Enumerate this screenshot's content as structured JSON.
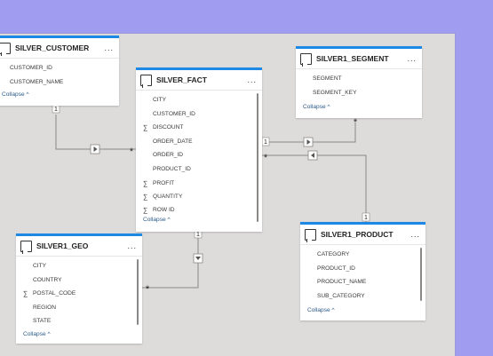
{
  "tables": {
    "customer": {
      "title": "SILVER_CUSTOMER",
      "more": "...",
      "fields": [
        "CUSTOMER_ID",
        "CUSTOMER_NAME"
      ],
      "collapse": "Collapse ^"
    },
    "segment": {
      "title": "SILVER1_SEGMENT",
      "more": "...",
      "fields": [
        "SEGMENT",
        "SEGMENT_KEY"
      ],
      "collapse": "Collapse ^"
    },
    "fact": {
      "title": "SILVER_FACT",
      "more": "...",
      "fields": [
        {
          "name": "CITY",
          "sigma": false
        },
        {
          "name": "CUSTOMER_ID",
          "sigma": false
        },
        {
          "name": "DISCOUNT",
          "sigma": true
        },
        {
          "name": "ORDER_DATE",
          "sigma": false
        },
        {
          "name": "ORDER_ID",
          "sigma": false
        },
        {
          "name": "PRODUCT_ID",
          "sigma": false
        },
        {
          "name": "PROFIT",
          "sigma": true
        },
        {
          "name": "QUANTITY",
          "sigma": true
        },
        {
          "name": "ROW ID",
          "sigma": true
        }
      ],
      "collapse": "Collapse ^"
    },
    "geo": {
      "title": "SILVER1_GEO",
      "more": "...",
      "fields": [
        {
          "name": "CITY",
          "sigma": false
        },
        {
          "name": "COUNTRY",
          "sigma": false
        },
        {
          "name": "POSTAL_CODE",
          "sigma": true
        },
        {
          "name": "REGION",
          "sigma": false
        },
        {
          "name": "STATE",
          "sigma": false
        }
      ],
      "collapse": "Collapse ^"
    },
    "product": {
      "title": "SILVER1_PRODUCT",
      "more": "...",
      "fields": [
        "CATEGORY",
        "PRODUCT_ID",
        "PRODUCT_NAME",
        "SUB_CATEGORY"
      ],
      "collapse": "Collapse ^"
    }
  },
  "relationships": {
    "customer_fact": {
      "from": "1",
      "to": "*"
    },
    "segment_fact": {
      "from": "*",
      "to": "1"
    },
    "product_fact": {
      "from": "1",
      "to": "*"
    },
    "fact_geo": {
      "from": "1",
      "to": "*"
    }
  },
  "sigma_symbol": "∑",
  "colors": {
    "accent": "#1e88e5",
    "canvas": "#dedcdb",
    "backdrop": "#a09cf0",
    "line": "#8a8886"
  }
}
